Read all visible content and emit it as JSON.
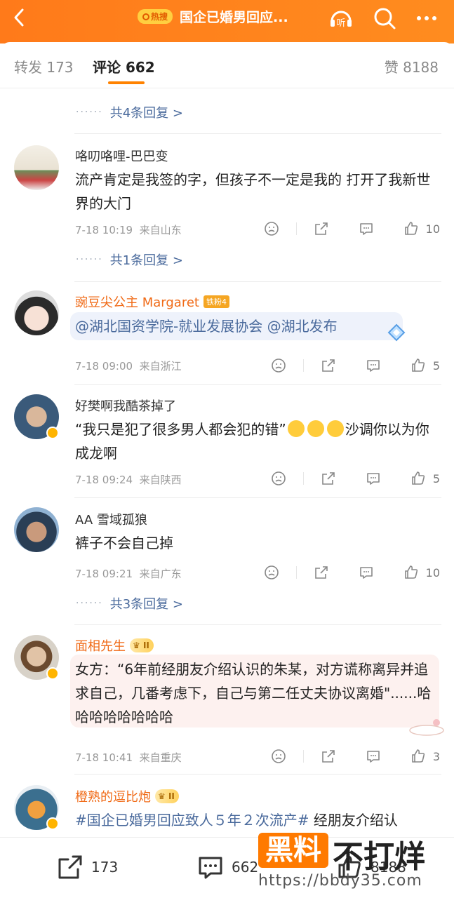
{
  "colors": {
    "accent": "#ff8200",
    "link": "#4a6a9c",
    "orange_name": "#f06a16"
  },
  "header": {
    "hot_tag": "热搜",
    "title": "国企已婚男回应...",
    "icons": [
      "back-icon",
      "listen-icon",
      "search-icon",
      "more-icon"
    ],
    "listen_label": "听"
  },
  "tabs": {
    "repost": "转发 173",
    "comment": "评论 662",
    "like": "赞 8188"
  },
  "top_replies": "共4条回复 >",
  "comments": [
    {
      "user": "咯叨咯哩-巴巴变",
      "text": "流产肯定是我签的字，但孩子不一定是我的   打开了我新世界的大门",
      "time": "7-18 10:19",
      "location": "来自山东",
      "likes": "10",
      "replies": "共1条回复 >"
    },
    {
      "user": "豌豆尖公主 Margaret",
      "fan_badge": "铁粉4",
      "mention1": "@湖北国资学院-就业发展协会",
      "mention2": "@湖北发布",
      "time": "7-18 09:00",
      "location": "来自浙江",
      "likes": "5"
    },
    {
      "user": "好樊啊我酷茶掉了",
      "text_a": "“我只是犯了很多男人都会犯的错”",
      "text_b": "沙调你以为你成龙啊",
      "time": "7-18 09:24",
      "location": "来自陕西",
      "likes": "5"
    },
    {
      "user": "AA 雪域孤狼",
      "text": "裤子不会自己掉",
      "time": "7-18 09:21",
      "location": "来自广东",
      "likes": "10",
      "replies": "共3条回复 >"
    },
    {
      "user": "面相先生",
      "badge": "II",
      "text": "女方：“6年前经朋友介绍认识的朱某，对方谎称离异并追求自己，几番考虑下，自己与第二任丈夫协议离婚\"......哈哈哈哈哈哈哈哈",
      "time": "7-18 10:41",
      "location": "来自重庆",
      "likes": "3"
    },
    {
      "user": "橙熟的逗比炮",
      "badge": "II",
      "topic": "#国企已婚男回应致人５年２次流产#",
      "text": " 经朋友介绍认"
    }
  ],
  "bottom": {
    "repost": "173",
    "comment": "662",
    "like": "8188"
  },
  "watermark": {
    "box": "黑料",
    "text": "不打烊",
    "url": "https://bbdy35.com"
  }
}
